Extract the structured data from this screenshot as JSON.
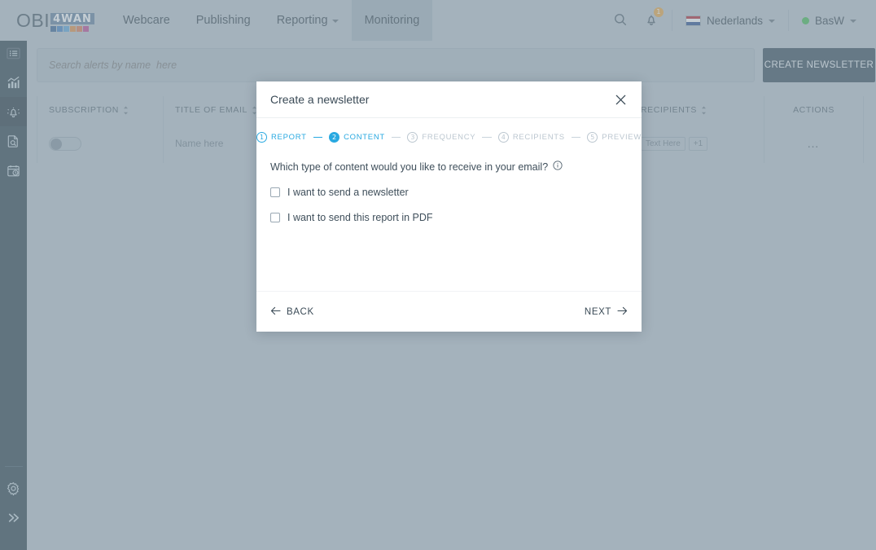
{
  "brand": {
    "logo_text": "OBI",
    "logo_badge": "4WAN",
    "dot_colors": [
      "#2f5b8f",
      "#3b7bbf",
      "#56a0d8",
      "#e08a3c",
      "#d9744a",
      "#b8408f"
    ]
  },
  "topnav": {
    "tabs": [
      {
        "label": "Webcare",
        "active": false,
        "has_caret": false
      },
      {
        "label": "Publishing",
        "active": false,
        "has_caret": false
      },
      {
        "label": "Reporting",
        "active": false,
        "has_caret": true
      },
      {
        "label": "Monitoring",
        "active": true,
        "has_caret": false
      }
    ],
    "search_icon": "search-icon",
    "notifications": {
      "icon": "bell-icon",
      "count": "1"
    },
    "language": {
      "label": "Nederlands",
      "flag": "netherlands-flag"
    },
    "user": {
      "name": "BasW",
      "status": "online"
    }
  },
  "sidebar": {
    "items": [
      {
        "name": "sidebar-item-list",
        "icon": "list-icon",
        "active": false
      },
      {
        "name": "sidebar-item-analytics",
        "icon": "bar-chart-icon",
        "active": false
      },
      {
        "name": "sidebar-item-alerts",
        "icon": "alert-bell-icon",
        "active": true
      },
      {
        "name": "sidebar-item-reports",
        "icon": "document-search-icon",
        "active": false
      },
      {
        "name": "sidebar-item-schedule",
        "icon": "calendar-clock-icon",
        "active": false
      }
    ],
    "bottom_items": [
      {
        "name": "sidebar-item-settings",
        "icon": "gear-icon"
      },
      {
        "name": "sidebar-item-expand",
        "icon": "chevron-double-right-icon"
      }
    ]
  },
  "toolbar": {
    "search_placeholder": "Search alerts by name  here",
    "search_value": "",
    "create_label": "CREATE NEWSLETTER"
  },
  "table": {
    "columns": [
      {
        "label": "SUBSCRIPTION",
        "sortable": true
      },
      {
        "label": "TITLE OF EMAIL",
        "sortable": true
      },
      {
        "label": "",
        "sortable": false
      },
      {
        "label": "",
        "sortable": false
      },
      {
        "label": "RECIPIENTS",
        "sortable": true
      },
      {
        "label": "ACTIONS",
        "sortable": false
      }
    ],
    "rows": [
      {
        "subscription_enabled": false,
        "title_of_email": "Name here",
        "col3": "",
        "col4": "",
        "recipients": [
          "Text Here",
          "+1"
        ],
        "actions": "…"
      }
    ]
  },
  "modal": {
    "title": "Create a newsletter",
    "close_icon": "close-icon",
    "steps": [
      {
        "num": "1",
        "label": "REPORT",
        "state": "done"
      },
      {
        "num": "2",
        "label": "CONTENT",
        "state": "current"
      },
      {
        "num": "3",
        "label": "FREQUENCY",
        "state": "todo"
      },
      {
        "num": "4",
        "label": "RECIPIENTS",
        "state": "todo"
      },
      {
        "num": "5",
        "label": "PREVIEW",
        "state": "todo"
      }
    ],
    "question": "Which type of content would you like to receive in your email?",
    "question_info_icon": "info-icon",
    "options": [
      {
        "label": "I want to send a newsletter",
        "checked": false
      },
      {
        "label": "I want to send this report in PDF",
        "checked": false
      }
    ],
    "back_label": "BACK",
    "next_label": "NEXT"
  },
  "colors": {
    "accent_blue": "#29a9e1",
    "rail_dark": "#223844",
    "page_bg": "#b6c2cb",
    "button_dark": "#2d4352",
    "badge_orange": "#e8a33d",
    "status_green": "#3bb54a"
  }
}
